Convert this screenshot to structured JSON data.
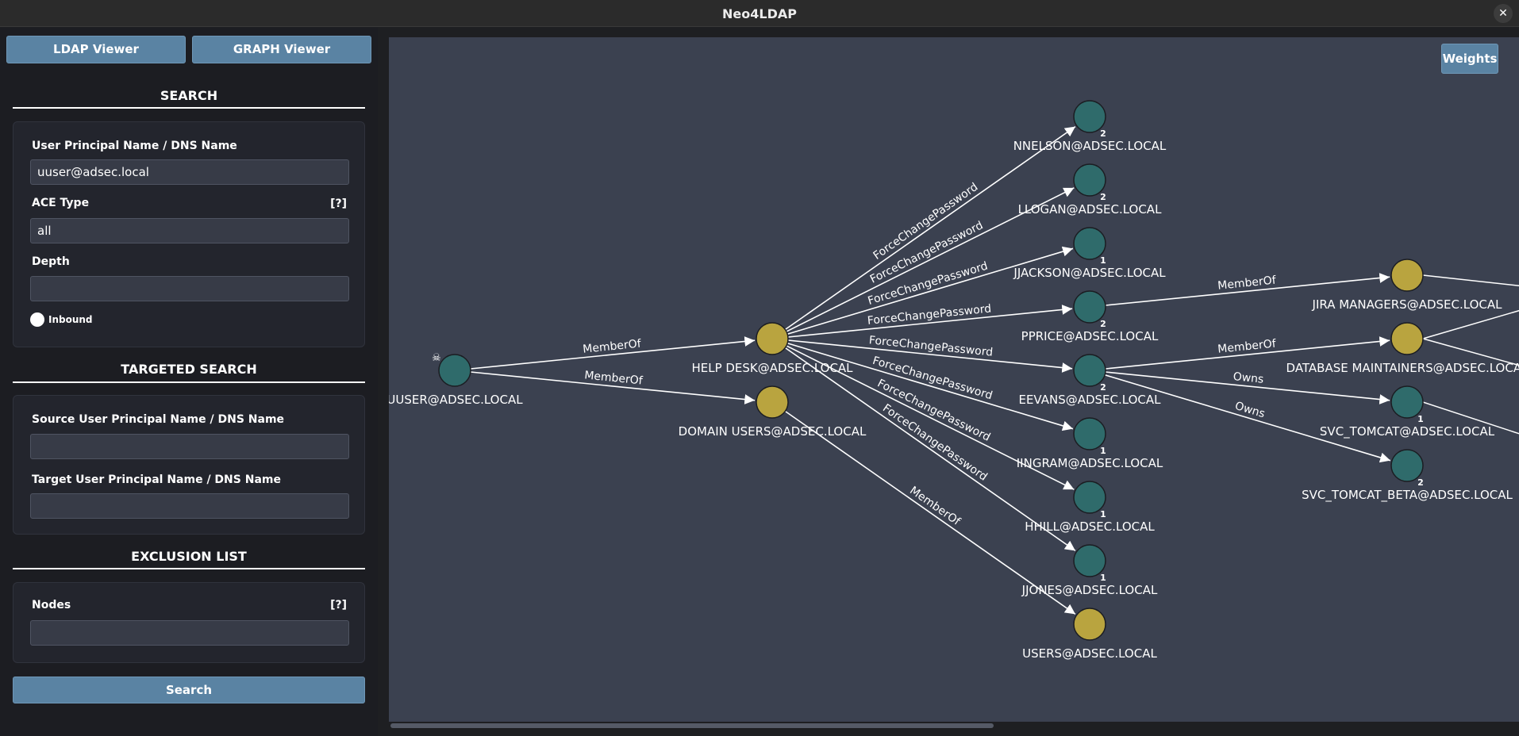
{
  "window": {
    "title": "Neo4LDAP",
    "close_label": "✕"
  },
  "sidebar": {
    "ldap_viewer": "LDAP Viewer",
    "graph_viewer": "GRAPH Viewer",
    "search": {
      "title": "SEARCH",
      "upn_label": "User Principal Name / DNS Name",
      "upn_value": "uuser@adsec.local",
      "ace_label": "ACE Type",
      "ace_help": "[?]",
      "ace_value": "all",
      "depth_label": "Depth",
      "depth_value": "",
      "inbound_label": "Inbound"
    },
    "targeted": {
      "title": "TARGETED SEARCH",
      "source_label": "Source User Principal Name / DNS Name",
      "source_value": "",
      "target_label": "Target User Principal Name / DNS Name",
      "target_value": ""
    },
    "exclusion": {
      "title": "EXCLUSION LIST",
      "nodes_label": "Nodes",
      "nodes_help": "[?]",
      "nodes_value": ""
    },
    "search_button": "Search"
  },
  "graph": {
    "weights_button": "Weights",
    "colors": {
      "user": "#2f6b6b",
      "group": "#b9a43f",
      "background": "#3b4150",
      "edge": "#ffffff"
    },
    "nodes": [
      {
        "id": "uuser",
        "label": "UUSER@ADSEC.LOCAL",
        "kind": "user",
        "owned": true
      },
      {
        "id": "helpdesk",
        "label": "HELP DESK@ADSEC.LOCAL",
        "kind": "group"
      },
      {
        "id": "domainusers",
        "label": "DOMAIN USERS@ADSEC.LOCAL",
        "kind": "group"
      },
      {
        "id": "nnelson",
        "label": "NNELSON@ADSEC.LOCAL",
        "kind": "user",
        "badge": "2"
      },
      {
        "id": "llogan",
        "label": "LLOGAN@ADSEC.LOCAL",
        "kind": "user",
        "badge": "2"
      },
      {
        "id": "jjackson",
        "label": "JJACKSON@ADSEC.LOCAL",
        "kind": "user",
        "badge": "1"
      },
      {
        "id": "pprice",
        "label": "PPRICE@ADSEC.LOCAL",
        "kind": "user",
        "badge": "2"
      },
      {
        "id": "eevans",
        "label": "EEVANS@ADSEC.LOCAL",
        "kind": "user",
        "badge": "2"
      },
      {
        "id": "iingram",
        "label": "IINGRAM@ADSEC.LOCAL",
        "kind": "user",
        "badge": "1"
      },
      {
        "id": "hhill",
        "label": "HHILL@ADSEC.LOCAL",
        "kind": "user",
        "badge": "1"
      },
      {
        "id": "jjones",
        "label": "JJONES@ADSEC.LOCAL",
        "kind": "user",
        "badge": "1"
      },
      {
        "id": "users",
        "label": "USERS@ADSEC.LOCAL",
        "kind": "group"
      },
      {
        "id": "jira",
        "label": "JIRA MANAGERS@ADSEC.LOCAL",
        "kind": "group"
      },
      {
        "id": "dbmaint",
        "label": "DATABASE MAINTAINERS@ADSEC.LOCAL",
        "kind": "group"
      },
      {
        "id": "svctomcat",
        "label": "SVC_TOMCAT@ADSEC.LOCAL",
        "kind": "user",
        "badge": "1"
      },
      {
        "id": "svctomcatbeta",
        "label": "SVC_TOMCAT_BETA@ADSEC.LOCAL",
        "kind": "user",
        "badge": "2"
      }
    ],
    "edges": [
      {
        "from": "uuser",
        "to": "helpdesk",
        "label": "MemberOf"
      },
      {
        "from": "uuser",
        "to": "domainusers",
        "label": "MemberOf"
      },
      {
        "from": "helpdesk",
        "to": "nnelson",
        "label": "ForceChangePassword"
      },
      {
        "from": "helpdesk",
        "to": "llogan",
        "label": "ForceChangePassword"
      },
      {
        "from": "helpdesk",
        "to": "jjackson",
        "label": "ForceChangePassword"
      },
      {
        "from": "helpdesk",
        "to": "pprice",
        "label": "ForceChangePassword"
      },
      {
        "from": "helpdesk",
        "to": "eevans",
        "label": "ForceChangePassword"
      },
      {
        "from": "helpdesk",
        "to": "iingram",
        "label": "ForceChangePassword"
      },
      {
        "from": "helpdesk",
        "to": "hhill",
        "label": "ForceChangePassword"
      },
      {
        "from": "helpdesk",
        "to": "jjones",
        "label": "ForceChangePassword"
      },
      {
        "from": "domainusers",
        "to": "users",
        "label": "MemberOf"
      },
      {
        "from": "pprice",
        "to": "jira",
        "label": "MemberOf"
      },
      {
        "from": "eevans",
        "to": "dbmaint",
        "label": "MemberOf"
      },
      {
        "from": "eevans",
        "to": "svctomcat",
        "label": "Owns"
      },
      {
        "from": "eevans",
        "to": "svctomcatbeta",
        "label": "Owns"
      }
    ]
  }
}
